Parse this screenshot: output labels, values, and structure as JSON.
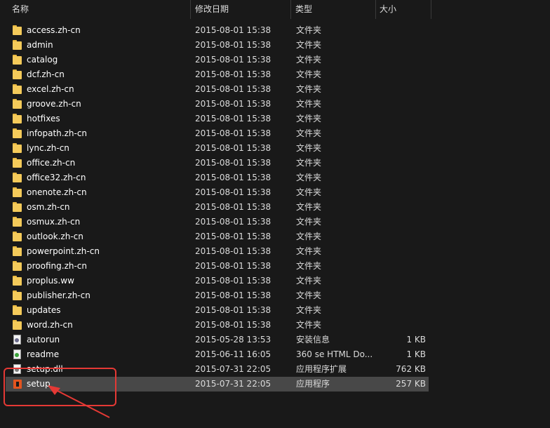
{
  "columns": {
    "name": "名称",
    "date": "修改日期",
    "type": "类型",
    "size": "大小"
  },
  "files": [
    {
      "name": "access.zh-cn",
      "date": "2015-08-01 15:38",
      "type": "文件夹",
      "size": "",
      "icon": "folder-icon"
    },
    {
      "name": "admin",
      "date": "2015-08-01 15:38",
      "type": "文件夹",
      "size": "",
      "icon": "folder-icon"
    },
    {
      "name": "catalog",
      "date": "2015-08-01 15:38",
      "type": "文件夹",
      "size": "",
      "icon": "folder-icon"
    },
    {
      "name": "dcf.zh-cn",
      "date": "2015-08-01 15:38",
      "type": "文件夹",
      "size": "",
      "icon": "folder-icon"
    },
    {
      "name": "excel.zh-cn",
      "date": "2015-08-01 15:38",
      "type": "文件夹",
      "size": "",
      "icon": "folder-icon"
    },
    {
      "name": "groove.zh-cn",
      "date": "2015-08-01 15:38",
      "type": "文件夹",
      "size": "",
      "icon": "folder-icon"
    },
    {
      "name": "hotfixes",
      "date": "2015-08-01 15:38",
      "type": "文件夹",
      "size": "",
      "icon": "folder-icon"
    },
    {
      "name": "infopath.zh-cn",
      "date": "2015-08-01 15:38",
      "type": "文件夹",
      "size": "",
      "icon": "folder-icon"
    },
    {
      "name": "lync.zh-cn",
      "date": "2015-08-01 15:38",
      "type": "文件夹",
      "size": "",
      "icon": "folder-icon"
    },
    {
      "name": "office.zh-cn",
      "date": "2015-08-01 15:38",
      "type": "文件夹",
      "size": "",
      "icon": "folder-icon"
    },
    {
      "name": "office32.zh-cn",
      "date": "2015-08-01 15:38",
      "type": "文件夹",
      "size": "",
      "icon": "folder-icon"
    },
    {
      "name": "onenote.zh-cn",
      "date": "2015-08-01 15:38",
      "type": "文件夹",
      "size": "",
      "icon": "folder-icon"
    },
    {
      "name": "osm.zh-cn",
      "date": "2015-08-01 15:38",
      "type": "文件夹",
      "size": "",
      "icon": "folder-icon"
    },
    {
      "name": "osmux.zh-cn",
      "date": "2015-08-01 15:38",
      "type": "文件夹",
      "size": "",
      "icon": "folder-icon"
    },
    {
      "name": "outlook.zh-cn",
      "date": "2015-08-01 15:38",
      "type": "文件夹",
      "size": "",
      "icon": "folder-icon"
    },
    {
      "name": "powerpoint.zh-cn",
      "date": "2015-08-01 15:38",
      "type": "文件夹",
      "size": "",
      "icon": "folder-icon"
    },
    {
      "name": "proofing.zh-cn",
      "date": "2015-08-01 15:38",
      "type": "文件夹",
      "size": "",
      "icon": "folder-icon"
    },
    {
      "name": "proplus.ww",
      "date": "2015-08-01 15:38",
      "type": "文件夹",
      "size": "",
      "icon": "folder-icon"
    },
    {
      "name": "publisher.zh-cn",
      "date": "2015-08-01 15:38",
      "type": "文件夹",
      "size": "",
      "icon": "folder-icon"
    },
    {
      "name": "updates",
      "date": "2015-08-01 15:38",
      "type": "文件夹",
      "size": "",
      "icon": "folder-icon"
    },
    {
      "name": "word.zh-cn",
      "date": "2015-08-01 15:38",
      "type": "文件夹",
      "size": "",
      "icon": "folder-icon"
    },
    {
      "name": "autorun",
      "date": "2015-05-28 13:53",
      "type": "安装信息",
      "size": "1 KB",
      "icon": "setup-info-icon"
    },
    {
      "name": "readme",
      "date": "2015-06-11 16:05",
      "type": "360 se HTML Do...",
      "size": "1 KB",
      "icon": "html-document-icon"
    },
    {
      "name": "setup.dll",
      "date": "2015-07-31 22:05",
      "type": "应用程序扩展",
      "size": "762 KB",
      "icon": "dll-file-icon"
    },
    {
      "name": "setup",
      "date": "2015-07-31 22:05",
      "type": "应用程序",
      "size": "257 KB",
      "icon": "office-setup-icon",
      "selected": true
    }
  ],
  "colors": {
    "background": "#191919",
    "selected_row": "#484848",
    "folder": "#f4ca5a",
    "highlight_annotation": "#e53935",
    "office_orange": "#e3541f"
  }
}
